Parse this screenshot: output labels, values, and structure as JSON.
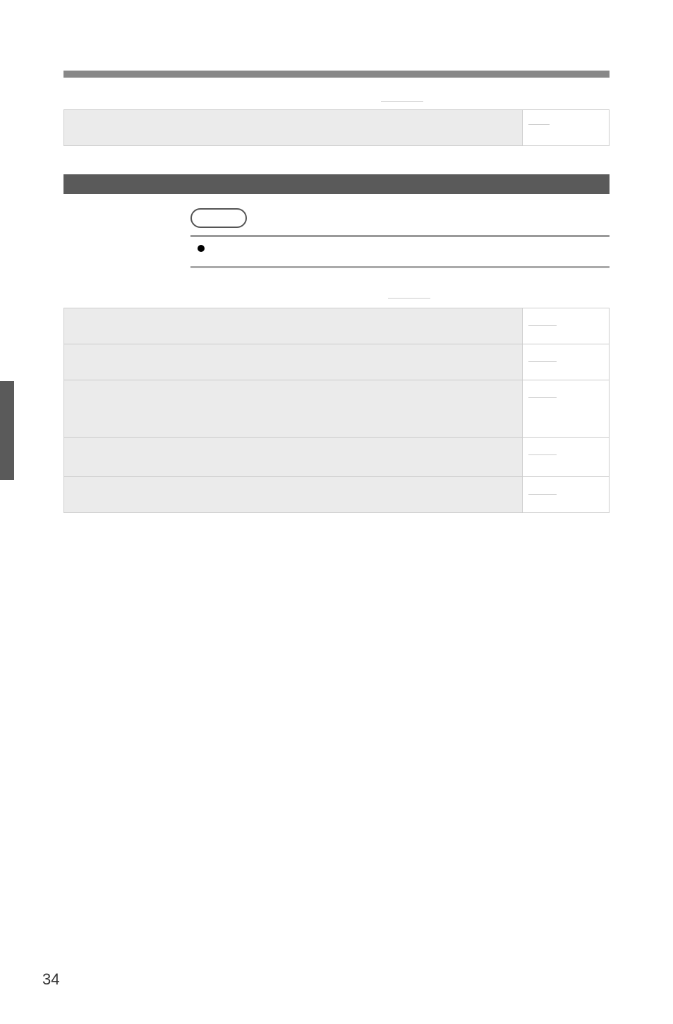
{
  "page_number": "34",
  "table1": {
    "left": "",
    "right": ""
  },
  "section_band": "",
  "bullet_text": "",
  "table2": {
    "rows": [
      {
        "left": "",
        "right": ""
      },
      {
        "left": "",
        "right": ""
      },
      {
        "left": "",
        "right": ""
      },
      {
        "left": "",
        "right": ""
      },
      {
        "left": "",
        "right": ""
      }
    ]
  }
}
